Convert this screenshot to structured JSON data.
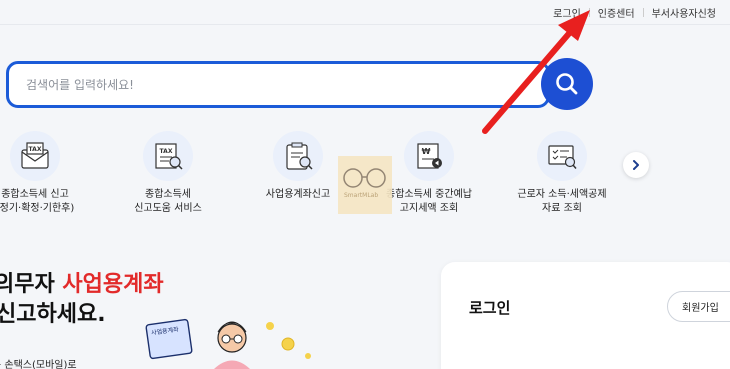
{
  "top_links": {
    "login": "로그인",
    "cert_center": "인증센터",
    "dept_user_request": "부서사용자신청"
  },
  "search": {
    "placeholder": "검색어를 입력하세요!"
  },
  "services": [
    {
      "line1": "종합소득세 신고",
      "line2": "(정기·확정·기한후)",
      "icon": "tax-envelope-icon"
    },
    {
      "line1": "종합소득세",
      "line2": "신고도움 서비스",
      "icon": "tax-document-search-icon"
    },
    {
      "line1": "사업용계좌신고",
      "line2": "",
      "icon": "clipboard-search-icon"
    },
    {
      "line1": "종합소득세 중간예납",
      "line2": "고지세액 조회",
      "icon": "won-document-icon"
    },
    {
      "line1": "근로자 소득·세액공제",
      "line2": "자료 조회",
      "icon": "checklist-search-icon"
    }
  ],
  "watermark": "SmartMLab",
  "promo": {
    "line1_prefix": "의무자 ",
    "line1_highlight": "사업용계좌",
    "line2": "신고하세요.",
    "line3": "는 손택스(모바일)로",
    "badge": "사업용계좌"
  },
  "login_panel": {
    "title": "로그인",
    "signup": "회원가입"
  },
  "colors": {
    "primary": "#1d4fd3",
    "highlight": "#e22a2a",
    "arrow": "#e8201f"
  }
}
